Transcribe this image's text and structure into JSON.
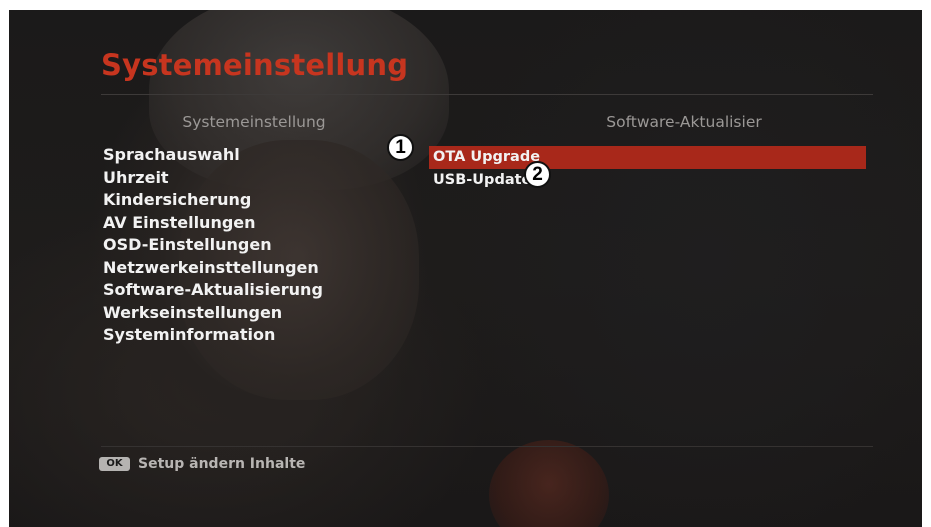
{
  "screen": {
    "title": "Systemeinstellung",
    "left_header": "Systemeinstellung",
    "right_header": "Software-Aktualisier"
  },
  "menu": {
    "items": [
      {
        "label": "Sprachauswahl"
      },
      {
        "label": "Uhrzeit"
      },
      {
        "label": "Kindersicherung"
      },
      {
        "label": "AV Einstellungen"
      },
      {
        "label": "OSD-Einstellungen"
      },
      {
        "label": "Netzwerkeinsttellungen"
      },
      {
        "label": "Software-Aktualisierung"
      },
      {
        "label": "Werkseinstellungen"
      },
      {
        "label": "Systeminformation"
      }
    ]
  },
  "submenu": {
    "items": [
      {
        "label": "OTA Upgrade",
        "selected": true
      },
      {
        "label": "USB-Update",
        "selected": false
      }
    ]
  },
  "annotations": {
    "badge1": "1",
    "badge2": "2"
  },
  "footer": {
    "key_label": "OK",
    "hint": "Setup ändern Inhalte"
  },
  "colors": {
    "accent": "#c7351f",
    "selection": "#a8281a",
    "text": "#f2f2f2",
    "muted": "#9b9896"
  }
}
